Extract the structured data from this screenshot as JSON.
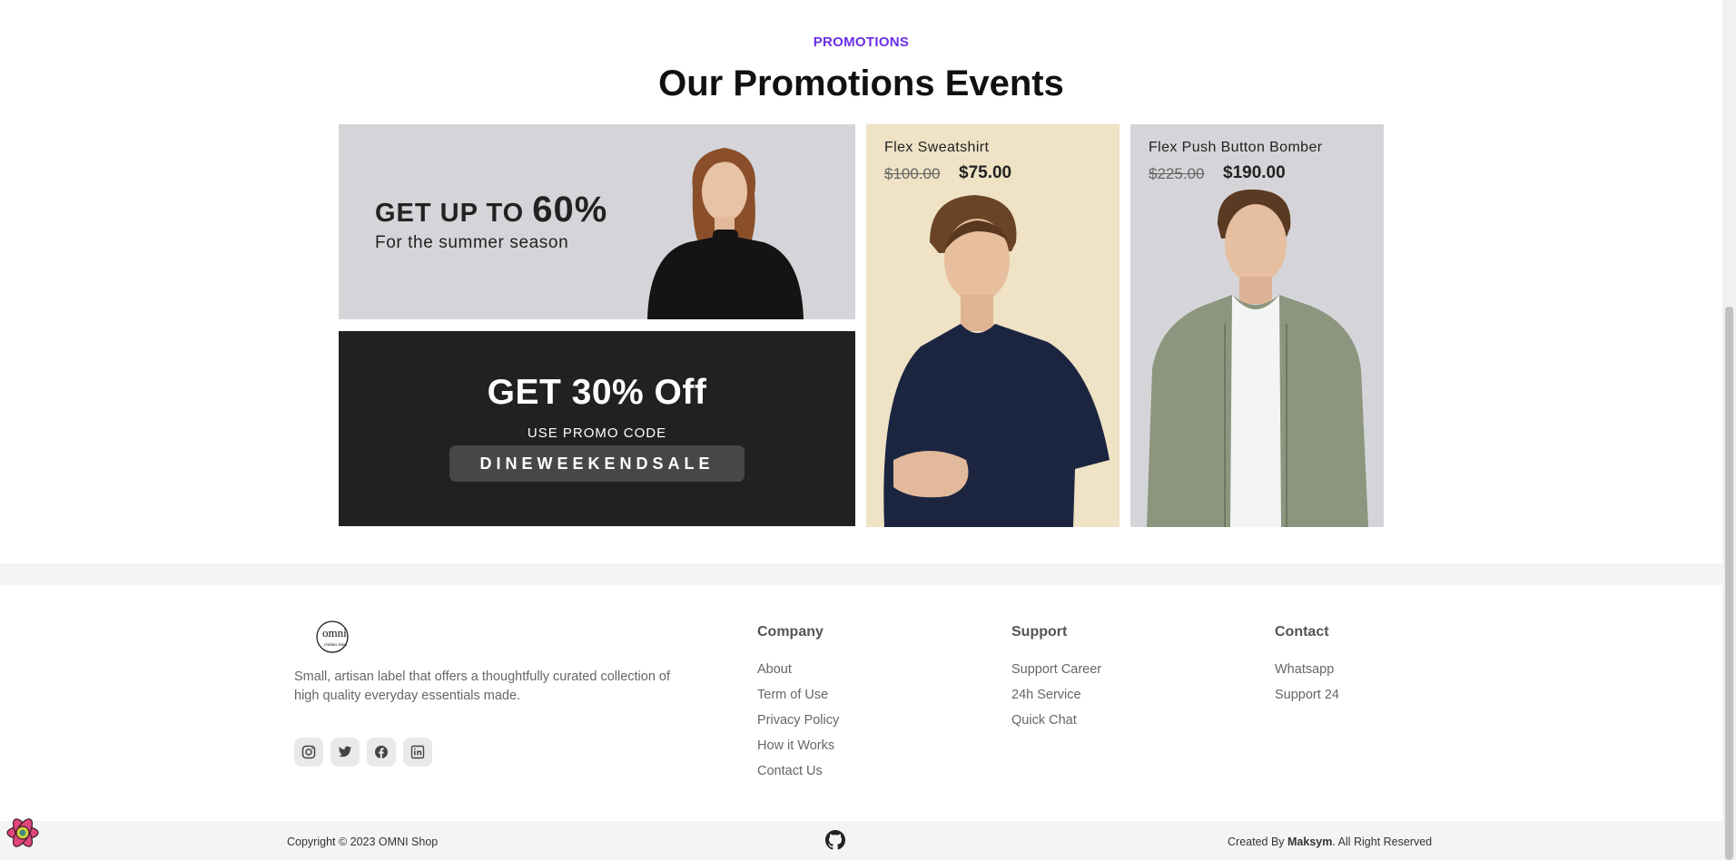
{
  "promotions": {
    "eyebrow": "PROMOTIONS",
    "heading": "Our Promotions Events"
  },
  "summer_card": {
    "line1_prefix": "GET UP TO ",
    "line1_percent": "60%",
    "line2": "For the summer season"
  },
  "promo_card": {
    "title": "GET 30% Off",
    "subtitle": "USE PROMO CODE",
    "code": "DINEWEEKENDSALE"
  },
  "products": [
    {
      "name": "Flex Sweatshirt",
      "old_price": "$100.00",
      "price": "$75.00",
      "bg_color": "#efe2c5"
    },
    {
      "name": "Flex Push Button Bomber",
      "old_price": "$225.00",
      "price": "$190.00",
      "bg_color": "#d5d5d9"
    }
  ],
  "footer": {
    "logo_text": "omni",
    "logo_subtext": "clothes shop",
    "tagline": "Small, artisan label that offers a thoughtfully curated collection of high quality everyday essentials made.",
    "social_icons": [
      "instagram-icon",
      "twitter-icon",
      "facebook-icon",
      "linkedin-icon"
    ],
    "columns": [
      {
        "title": "Company",
        "links": [
          "About",
          "Term of Use",
          "Privacy Policy",
          "How it Works",
          "Contact Us"
        ]
      },
      {
        "title": "Support",
        "links": [
          "Support Career",
          "24h Service",
          "Quick Chat"
        ]
      },
      {
        "title": "Contact",
        "links": [
          "Whatsapp",
          "Support 24"
        ]
      }
    ],
    "copyright": "Copyright © 2023 OMNI Shop",
    "credits_prefix": "Created By ",
    "credits_author": "Maksym",
    "credits_suffix": ". All Right Reserved"
  },
  "colors": {
    "accent": "#6b2ee6",
    "promo_dark": "#212121"
  }
}
